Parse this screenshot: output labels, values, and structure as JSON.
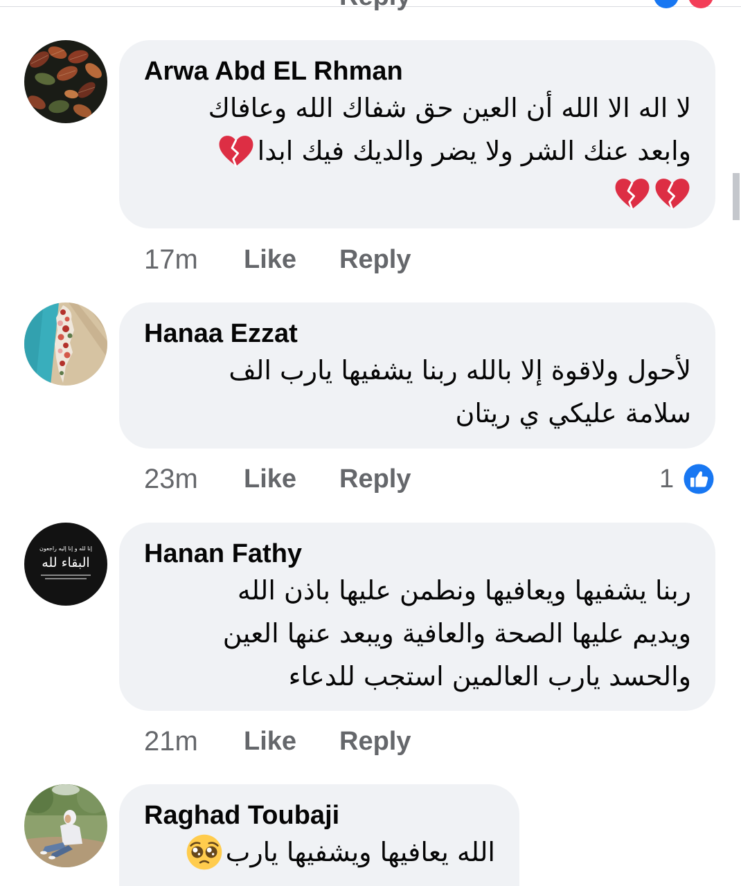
{
  "previous_comment": {
    "reply_label": "Reply",
    "reaction_icons": [
      "like-reaction-icon",
      "love-reaction-icon"
    ]
  },
  "colors": {
    "bubble": "#f0f2f5",
    "text": "#050505",
    "meta": "#65676b",
    "like_blue": "#1877f2",
    "love_red": "#f33e58",
    "broken_heart": "#dd2e44"
  },
  "comments": [
    {
      "author": "Arwa Abd EL Rhman",
      "lines": [
        {
          "text": "لا اله الا الله أن العين حق شفاك الله وعافاك"
        },
        {
          "text": "وابعد عنك الشر ولا يضر والديك فيك ابدا",
          "emoji": [
            "broken-heart-icon"
          ]
        },
        {
          "emoji": [
            "broken-heart-icon",
            "broken-heart-icon"
          ]
        }
      ],
      "time": "17m",
      "like_label": "Like",
      "reply_label": "Reply"
    },
    {
      "author": "Hanaa Ezzat",
      "lines": [
        {
          "text": "لأحول ولاقوة إلا بالله ربنا يشفيها يارب الف"
        },
        {
          "text": "سلامة عليكي ي ريتان"
        }
      ],
      "time": "23m",
      "like_label": "Like",
      "reply_label": "Reply",
      "reaction_count": "1",
      "reaction_icon": "like-icon"
    },
    {
      "author": "Hanan Fathy",
      "avatar": {
        "subcaption": "إنا لله و إنا إليه راجعون",
        "caption": "البقاء لله"
      },
      "lines": [
        {
          "text": "ربنا يشفيها ويعافيها ونطمن عليها باذن الله"
        },
        {
          "text": "ويديم عليها الصحة والعافية ويبعد عنها العين"
        },
        {
          "text": "والحسد يارب العالمين استجب للدعاء"
        }
      ],
      "time": "21m",
      "like_label": "Like",
      "reply_label": "Reply"
    },
    {
      "author": "Raghad Toubaji",
      "lines": [
        {
          "text": "الله يعافيها ويشفيها يارب",
          "emoji": [
            "pleading-face-icon"
          ]
        }
      ]
    }
  ]
}
